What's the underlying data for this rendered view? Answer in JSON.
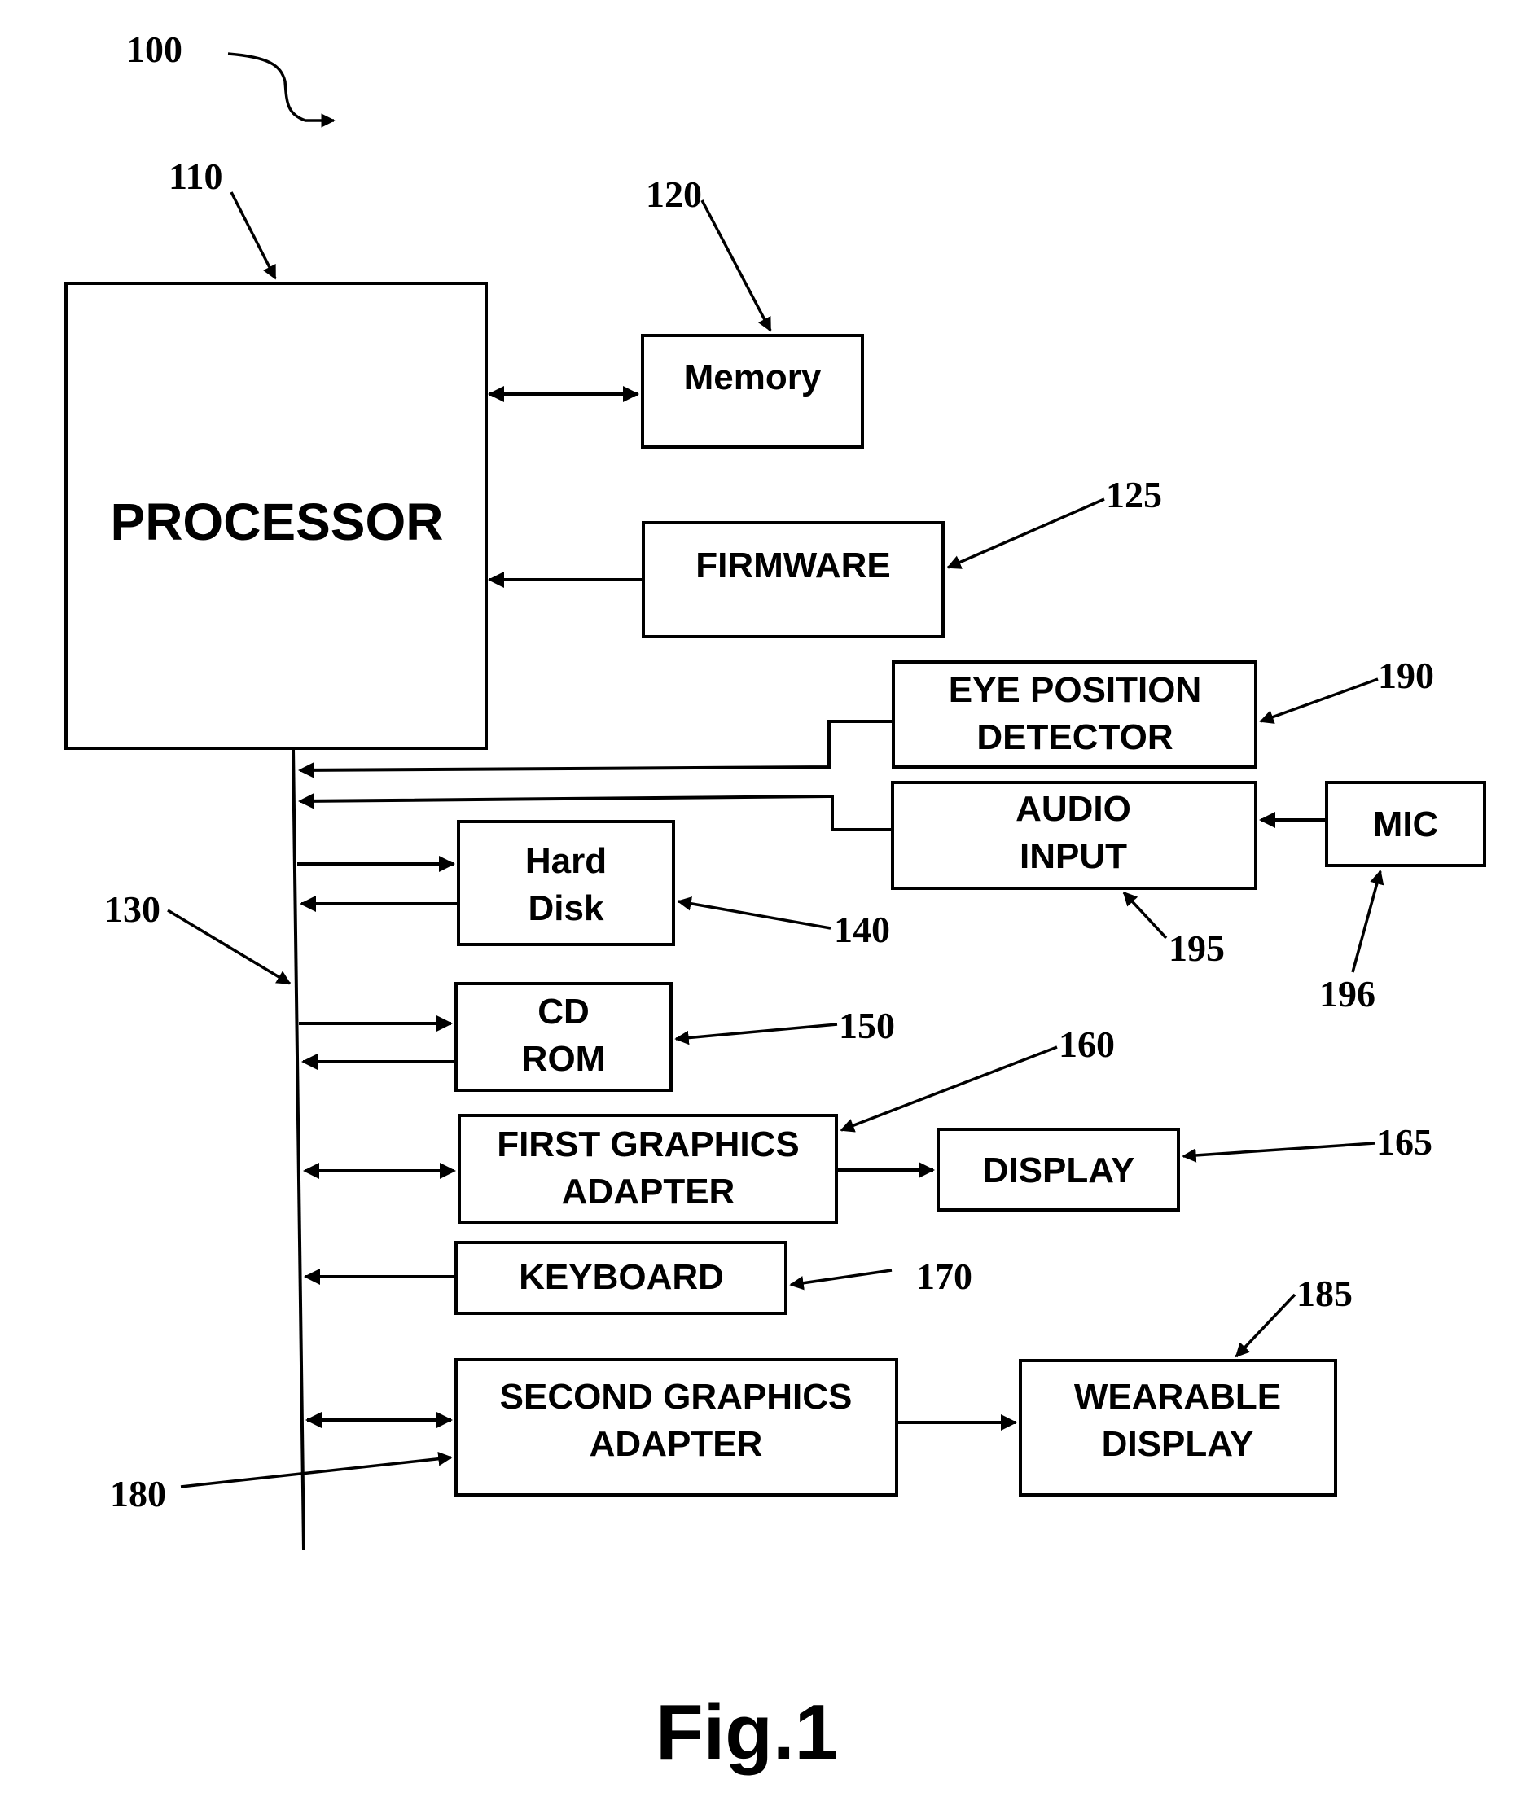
{
  "figure": {
    "caption": "Fig.1",
    "system_ref": "100",
    "blocks": {
      "processor": {
        "label": "PROCESSOR",
        "ref": "110"
      },
      "memory": {
        "label": "Memory",
        "ref": "120"
      },
      "firmware": {
        "label": "FIRMWARE",
        "ref": "125"
      },
      "bus": {
        "ref": "130"
      },
      "eye_position_detector": {
        "lines": [
          "EYE POSITION",
          "DETECTOR"
        ],
        "ref": "190"
      },
      "audio_input": {
        "lines": [
          "AUDIO",
          "INPUT"
        ],
        "ref": "195"
      },
      "mic": {
        "label": "MIC",
        "ref": "196"
      },
      "hard_disk": {
        "lines": [
          "Hard",
          "Disk"
        ],
        "ref": "140"
      },
      "cd_rom": {
        "lines": [
          "CD",
          "ROM"
        ],
        "ref": "150"
      },
      "first_graphics_adapter": {
        "lines": [
          "FIRST GRAPHICS",
          "ADAPTER"
        ],
        "ref": "160"
      },
      "display": {
        "label": "DISPLAY",
        "ref": "165"
      },
      "keyboard": {
        "label": "KEYBOARD",
        "ref": "170"
      },
      "second_graphics_adapter": {
        "lines": [
          "SECOND GRAPHICS",
          "ADAPTER"
        ],
        "ref": "180"
      },
      "wearable_display": {
        "lines": [
          "WEARABLE",
          "DISPLAY"
        ],
        "ref": "185"
      }
    }
  }
}
